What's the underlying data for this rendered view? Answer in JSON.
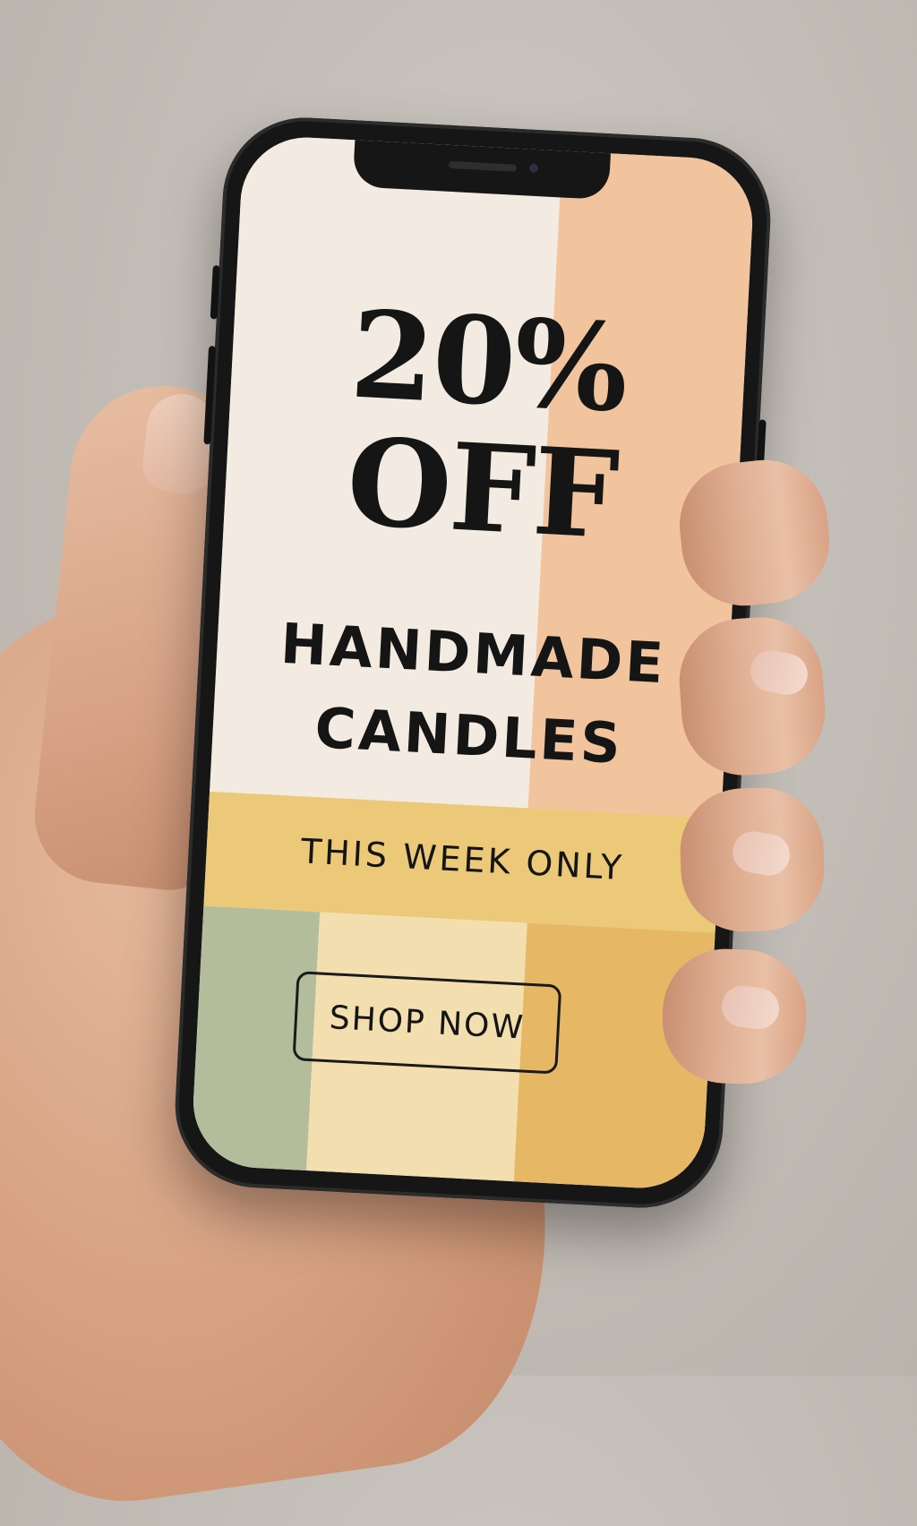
{
  "promo": {
    "discount": "20%",
    "discount_word": "OFF",
    "product_line1": "HANDMADE",
    "product_line2": "CANDLES",
    "tagline": "THIS WEEK ONLY",
    "cta_label": "SHOP NOW"
  },
  "colors": {
    "cream": "#f3ebe1",
    "peach": "#f1c49d",
    "yellow": "#ecc978",
    "sage": "#b4bd9b",
    "sand": "#f2deaf",
    "gold": "#e6b865",
    "ink": "#151515"
  }
}
